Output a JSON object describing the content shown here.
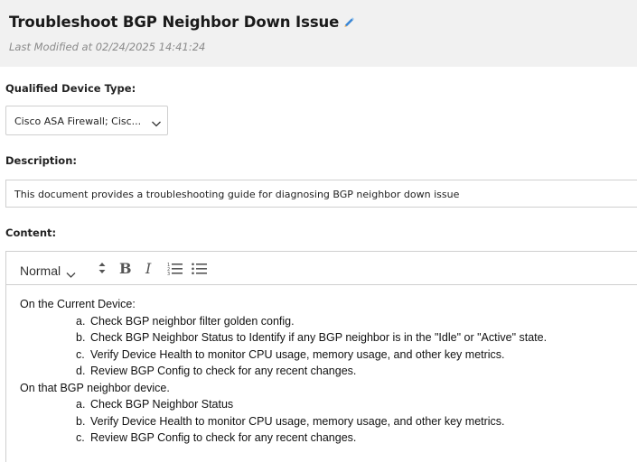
{
  "page": {
    "title": "Troubleshoot BGP Neighbor Down Issue",
    "last_modified": "Last Modified at 02/24/2025 14:41:24"
  },
  "icons": {
    "edit": "pencil-edit-icon",
    "dropdown": "chevron-down-icon",
    "line_height": "line-height-icon",
    "bold": "bold-icon",
    "italic": "italic-icon",
    "ordered_list": "ordered-list-icon",
    "bullet_list": "bullet-list-icon"
  },
  "colors": {
    "header_bg": "#f1f1f1",
    "edit_icon_blue": "#3a86d4",
    "edit_icon_orange": "#f0a33a",
    "border": "#cfcfcf",
    "muted_text": "#8a8a8a"
  },
  "qualified_device_type": {
    "label": "Qualified Device Type:",
    "value": "Cisco ASA Firewall; Cisc..."
  },
  "description": {
    "label": "Description:",
    "value": "This document provides a troubleshooting guide for diagnosing BGP neighbor down issue"
  },
  "content": {
    "label": "Content:",
    "toolbar": {
      "style": "Normal",
      "bold": "B",
      "italic": "I"
    },
    "sections": [
      {
        "heading": "On the Current Device:",
        "items": [
          {
            "marker": "a.",
            "text": "Check BGP neighbor filter golden config."
          },
          {
            "marker": "b.",
            "text": "Check BGP Neighbor Status to Identify if any BGP neighbor is in the \"Idle\" or \"Active\" state."
          },
          {
            "marker": "c.",
            "text": "Verify Device Health to monitor CPU usage, memory usage, and other key metrics."
          },
          {
            "marker": "d.",
            "text": "Review BGP Config to check for any recent changes."
          }
        ]
      },
      {
        "heading": "On that BGP neighbor device.",
        "items": [
          {
            "marker": "a.",
            "text": "Check BGP Neighbor Status"
          },
          {
            "marker": "b.",
            "text": "Verify Device Health to monitor CPU usage, memory usage, and other key metrics."
          },
          {
            "marker": "c.",
            "text": "Review BGP Config to check for any recent changes."
          }
        ]
      }
    ]
  }
}
